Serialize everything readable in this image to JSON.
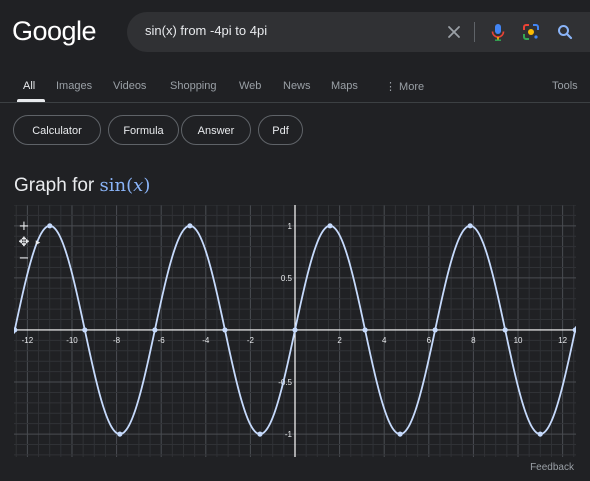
{
  "header": {
    "logo": "Google",
    "search_query": "sin(x) from -4pi to 4pi"
  },
  "icons": {
    "clear": "close-icon",
    "voice": "microphone-icon",
    "lens": "lens-icon",
    "search": "search-icon"
  },
  "tabs": [
    {
      "label": "All",
      "active": true
    },
    {
      "label": "Images"
    },
    {
      "label": "Videos"
    },
    {
      "label": "Shopping"
    },
    {
      "label": "Web"
    },
    {
      "label": "News"
    },
    {
      "label": "Maps"
    },
    {
      "label": "⋮ More"
    }
  ],
  "tools_label": "Tools",
  "chips": [
    "Calculator",
    "Formula",
    "Answer",
    "Pdf"
  ],
  "graph": {
    "title_prefix": "Graph for",
    "title_func": "sin",
    "title_open": "(",
    "title_var": "x",
    "title_close": ")",
    "zoom_in": "+",
    "pan": "✥",
    "zoom_out": "−",
    "feedback": "Feedback"
  },
  "colors": {
    "background": "#202124",
    "curve": "#c6dafc",
    "grid": "#3c4043",
    "axis": "#ffffff"
  },
  "chart_data": {
    "type": "line",
    "function": "sin(x)",
    "xlim": [
      -12.6,
      12.6
    ],
    "ylim": [
      -1.22,
      1.2
    ],
    "x_ticks": [
      -12,
      -10,
      -8,
      -6,
      -4,
      -2,
      2,
      4,
      6,
      8,
      10,
      12
    ],
    "y_ticks": [
      1,
      0.5,
      -0.5,
      -1
    ],
    "grid": true,
    "series": [
      {
        "x": [
          -12.566,
          -10.996,
          -9.425,
          -7.854,
          -6.283,
          -4.712,
          -3.142,
          -1.571,
          0,
          1.571,
          3.142,
          4.712,
          6.283,
          7.854,
          9.425,
          10.996,
          12.566
        ],
        "y": [
          0,
          1,
          0,
          -1,
          0,
          1,
          0,
          -1,
          0,
          1,
          0,
          -1,
          0,
          1,
          0,
          -1,
          0
        ]
      }
    ]
  }
}
